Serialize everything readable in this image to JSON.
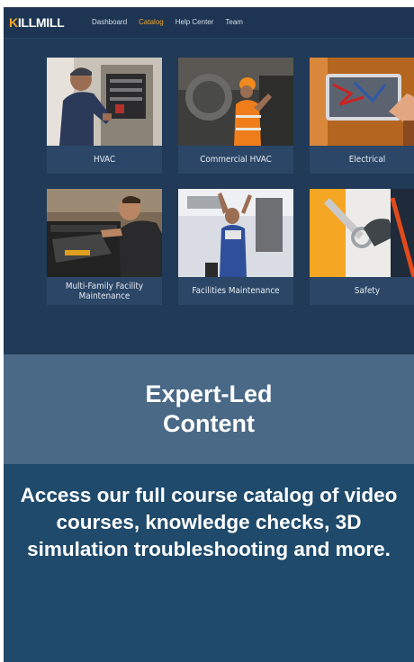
{
  "app": {
    "logo_prefix": "K",
    "logo_text": "ILLMILL"
  },
  "nav": {
    "items": [
      "Dashboard",
      "Catalog",
      "Help Center",
      "Team"
    ],
    "active": "Catalog"
  },
  "catalog": {
    "cards": [
      {
        "label": "HVAC",
        "image": "hvac-technician-photo"
      },
      {
        "label": "Commercial HVAC",
        "image": "commercial-hvac-photo"
      },
      {
        "label": "Electrical",
        "image": "electrical-panel-photo"
      },
      {
        "label": "Multi-Family Facility Maintenance",
        "image": "oven-repair-photo"
      },
      {
        "label": "Facilities Maintenance",
        "image": "ceiling-work-photo"
      },
      {
        "label": "Safety",
        "image": "safety-harness-photo"
      }
    ]
  },
  "promo": {
    "headline": "Expert-Led Content",
    "description": "Access our full course catalog of video courses, knowledge checks, 3D simulation troubleshooting and more."
  },
  "colors": {
    "accent": "#f5a623",
    "background": "#203a58",
    "band": "#4a6986",
    "panel": "#1f4a6b"
  }
}
